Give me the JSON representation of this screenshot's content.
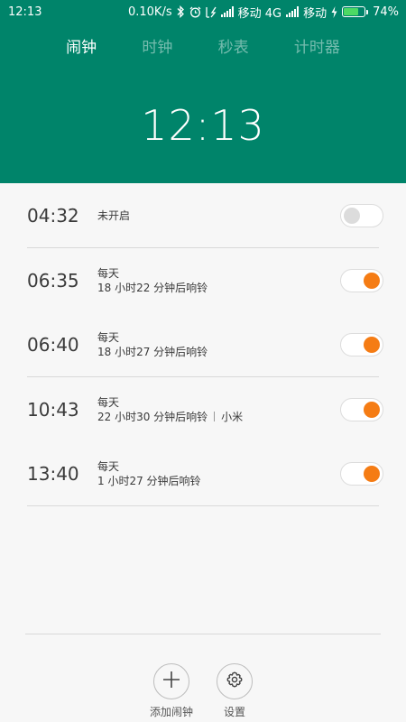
{
  "status_bar": {
    "time": "12:13",
    "net_speed": "0.10K/s",
    "carrier1": "移动 4G",
    "carrier2": "移动",
    "battery_percent": "74%",
    "battery_level": 0.74,
    "icons": [
      "bluetooth-icon",
      "alarm-clock-icon",
      "vibrate-icon",
      "signal-icon",
      "charging-icon",
      "battery-icon"
    ]
  },
  "tabs": [
    {
      "label": "闹钟",
      "active": true
    },
    {
      "label": "时钟",
      "active": false
    },
    {
      "label": "秒表",
      "active": false
    },
    {
      "label": "计时器",
      "active": false
    }
  ],
  "clock": {
    "time": "12:13"
  },
  "alarms": [
    {
      "time": "04:32",
      "line1": "未开启",
      "line2": "",
      "tag": "",
      "enabled": false
    },
    {
      "time": "06:35",
      "line1": "每天",
      "line2": "18 小时22 分钟后响铃",
      "tag": "",
      "enabled": true
    },
    {
      "time": "06:40",
      "line1": "每天",
      "line2": "18 小时27 分钟后响铃",
      "tag": "",
      "enabled": true
    },
    {
      "time": "10:43",
      "line1": "每天",
      "line2": "22 小时30 分钟后响铃",
      "tag": "小米",
      "enabled": true
    },
    {
      "time": "13:40",
      "line1": "每天",
      "line2": "1 小时27 分钟后响铃",
      "tag": "",
      "enabled": true
    }
  ],
  "actions": {
    "add_label": "添加闹钟",
    "settings_label": "设置"
  },
  "colors": {
    "header": "#00846a",
    "toggle_on": "#f57c14",
    "toggle_off": "#dcdcdc"
  }
}
